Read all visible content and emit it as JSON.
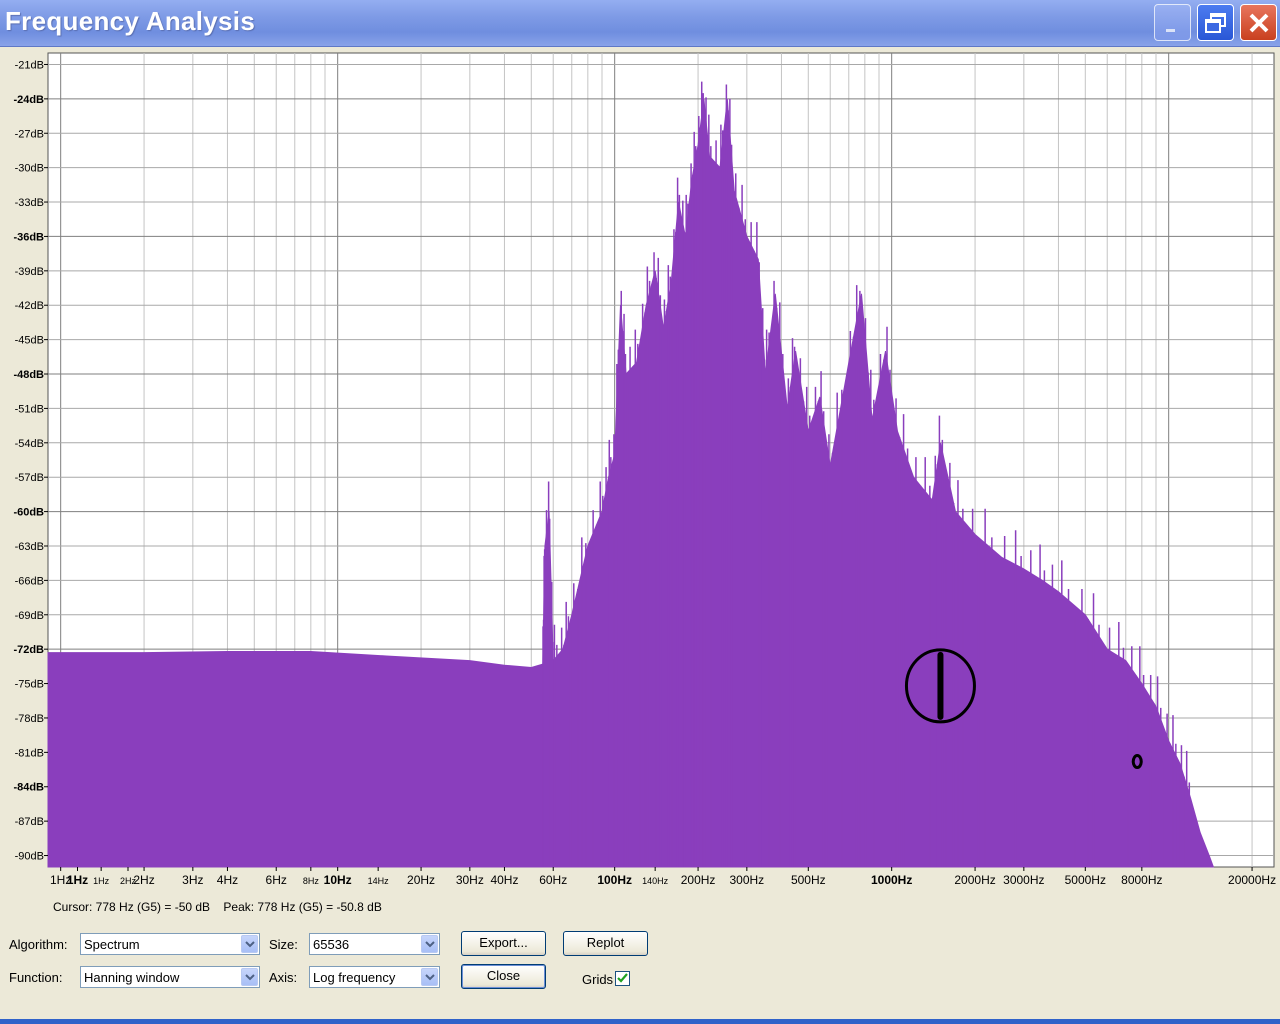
{
  "window": {
    "title": "Frequency Analysis",
    "buttons": {
      "minimize_icon": "minimize-icon",
      "restore_icon": "restore-icon",
      "close_icon": "close-icon"
    }
  },
  "status": {
    "cursor": "Cursor: 778 Hz (G5) = -50 dB",
    "peak": "Peak: 778 Hz (G5) = -50.8 dB"
  },
  "controls": {
    "algorithm_label": "Algorithm:",
    "algorithm_value": "Spectrum",
    "size_label": "Size:",
    "size_value": "65536",
    "function_label": "Function:",
    "function_value": "Hanning window",
    "axis_label": "Axis:",
    "axis_value": "Log frequency",
    "export_label": "Export...",
    "replot_label": "Replot",
    "close_label": "Close",
    "grids_label": "Grids",
    "grids_checked": true
  },
  "colors": {
    "spectrum_fill": "#8a3ebd",
    "grid_major": "#7f7f7f",
    "grid_minor": "#c4c4c4"
  },
  "chart_data": {
    "type": "area",
    "x_scale": "log",
    "y_unit": "dB",
    "ylim": [
      -91,
      -20
    ],
    "xlim": [
      0.9,
      24000
    ],
    "grid": true,
    "y_ticks": [
      "-21dB",
      "-24dB",
      "-27dB",
      "-30dB",
      "-33dB",
      "-36dB",
      "-39dB",
      "-42dB",
      "-45dB",
      "-48dB",
      "-51dB",
      "-54dB",
      "-57dB",
      "-60dB",
      "-63dB",
      "-66dB",
      "-69dB",
      "-72dB",
      "-75dB",
      "-78dB",
      "-81dB",
      "-84dB",
      "-87dB",
      "-90dB"
    ],
    "y_tick_values": [
      -21,
      -24,
      -27,
      -30,
      -33,
      -36,
      -39,
      -42,
      -45,
      -48,
      -51,
      -54,
      -57,
      -60,
      -63,
      -66,
      -69,
      -72,
      -75,
      -78,
      -81,
      -84,
      -87,
      -90
    ],
    "y_bold_values": [
      -24,
      -36,
      -48,
      -60,
      -72,
      -84
    ],
    "x_ticks": [
      {
        "hz": 1,
        "label": "1Hz"
      },
      {
        "hz": 1.15,
        "label": "1Hz",
        "bold": true
      },
      {
        "hz": 1.4,
        "label": "1Hz",
        "small": true
      },
      {
        "hz": 1.75,
        "label": "2Hz",
        "small": true
      },
      {
        "hz": 2,
        "label": "2Hz"
      },
      {
        "hz": 3,
        "label": "3Hz"
      },
      {
        "hz": 4,
        "label": "4Hz"
      },
      {
        "hz": 6,
        "label": "6Hz"
      },
      {
        "hz": 8,
        "label": "8Hz",
        "small": true
      },
      {
        "hz": 10,
        "label": "10Hz",
        "bold": true
      },
      {
        "hz": 14,
        "label": "14Hz",
        "small": true
      },
      {
        "hz": 20,
        "label": "20Hz"
      },
      {
        "hz": 30,
        "label": "30Hz"
      },
      {
        "hz": 40,
        "label": "40Hz"
      },
      {
        "hz": 60,
        "label": "60Hz"
      },
      {
        "hz": 100,
        "label": "100Hz",
        "bold": true
      },
      {
        "hz": 140,
        "label": "140Hz",
        "small": true
      },
      {
        "hz": 200,
        "label": "200Hz"
      },
      {
        "hz": 300,
        "label": "300Hz"
      },
      {
        "hz": 500,
        "label": "500Hz"
      },
      {
        "hz": 1000,
        "label": "1000Hz",
        "bold": true
      },
      {
        "hz": 2000,
        "label": "2000Hz"
      },
      {
        "hz": 3000,
        "label": "3000Hz"
      },
      {
        "hz": 5000,
        "label": "5000Hz"
      },
      {
        "hz": 8000,
        "label": "8000Hz"
      },
      {
        "hz": 20000,
        "label": "20000Hz"
      }
    ],
    "series": [
      {
        "points": [
          [
            1,
            -72.3
          ],
          [
            2,
            -72.3
          ],
          [
            4,
            -72.2
          ],
          [
            8,
            -72.2
          ],
          [
            15,
            -72.6
          ],
          [
            30,
            -73.0
          ],
          [
            40,
            -73.4
          ],
          [
            50,
            -73.6
          ],
          [
            55,
            -73.3
          ],
          [
            56,
            -63.0
          ],
          [
            58,
            -60.0
          ],
          [
            60,
            -73.0
          ],
          [
            65,
            -72.0
          ],
          [
            70,
            -69.0
          ],
          [
            80,
            -63.0
          ],
          [
            90,
            -60.0
          ],
          [
            95,
            -57.0
          ],
          [
            100,
            -55.0
          ],
          [
            105,
            -42.0
          ],
          [
            110,
            -48.0
          ],
          [
            120,
            -47.0
          ],
          [
            130,
            -42.0
          ],
          [
            140,
            -39.0
          ],
          [
            150,
            -44.0
          ],
          [
            160,
            -40.0
          ],
          [
            170,
            -33.0
          ],
          [
            180,
            -36.0
          ],
          [
            190,
            -31.0
          ],
          [
            200,
            -28.0
          ],
          [
            210,
            -24.0
          ],
          [
            220,
            -29.0
          ],
          [
            240,
            -30.0
          ],
          [
            255,
            -24.0
          ],
          [
            270,
            -32.0
          ],
          [
            300,
            -36.0
          ],
          [
            330,
            -38.0
          ],
          [
            350,
            -48.0
          ],
          [
            380,
            -41.0
          ],
          [
            420,
            -51.0
          ],
          [
            450,
            -46.0
          ],
          [
            500,
            -53.0
          ],
          [
            550,
            -50.0
          ],
          [
            600,
            -56.0
          ],
          [
            700,
            -47.0
          ],
          [
            778,
            -41.0
          ],
          [
            850,
            -52.0
          ],
          [
            950,
            -46.0
          ],
          [
            1050,
            -53.0
          ],
          [
            1200,
            -57.0
          ],
          [
            1400,
            -59.0
          ],
          [
            1500,
            -54.0
          ],
          [
            1700,
            -60.0
          ],
          [
            2000,
            -62.0
          ],
          [
            2500,
            -64.0
          ],
          [
            3000,
            -65.0
          ],
          [
            3500,
            -66.0
          ],
          [
            4000,
            -67.0
          ],
          [
            5000,
            -69.0
          ],
          [
            6000,
            -72.0
          ],
          [
            7000,
            -73.0
          ],
          [
            8000,
            -75.0
          ],
          [
            9000,
            -77.0
          ],
          [
            10000,
            -80.0
          ],
          [
            11000,
            -82.0
          ],
          [
            12000,
            -85.0
          ],
          [
            13000,
            -88.0
          ],
          [
            14000,
            -90.0
          ],
          [
            14500,
            -91.0
          ]
        ]
      }
    ],
    "annotations": [
      {
        "hz": 1500,
        "db": -75.2,
        "shape": "circle-bar"
      },
      {
        "hz": 7700,
        "db": -81.8,
        "shape": "small-ring"
      }
    ]
  }
}
